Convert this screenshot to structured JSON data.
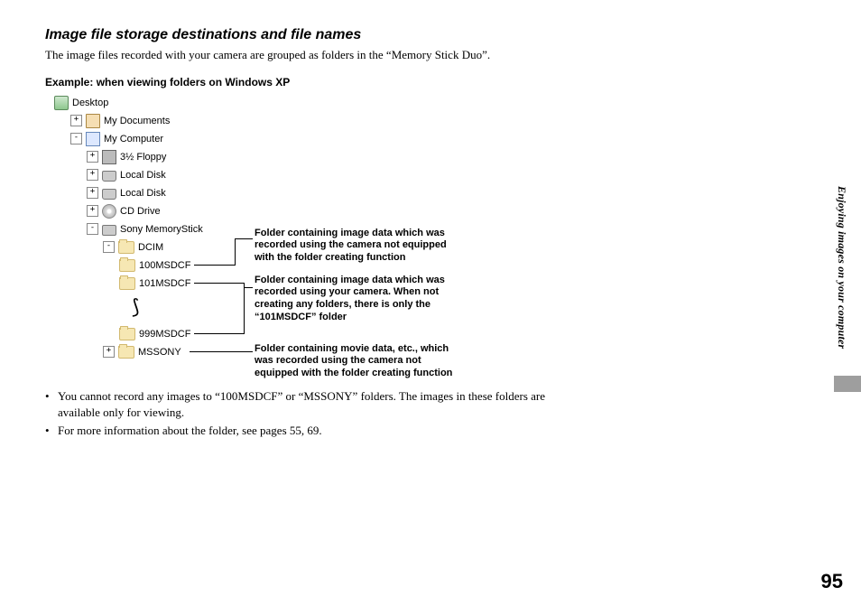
{
  "title": "Image file storage destinations and file names",
  "intro": "The image files recorded with your camera are grouped as folders in the “Memory Stick Duo”.",
  "example_label": "Example: when viewing folders on Windows XP",
  "tree": {
    "desktop": "Desktop",
    "documents": "My Documents",
    "computer": "My Computer",
    "floppy": "3½ Floppy",
    "local_disk_1": "Local Disk",
    "local_disk_2": "Local Disk",
    "cd_drive": "CD Drive",
    "memorystick": "Sony MemoryStick",
    "dcim": "DCIM",
    "f100": "100MSDCF",
    "f101": "101MSDCF",
    "f999": "999MSDCF",
    "mssony": "MSSONY"
  },
  "callouts": {
    "c1": "Folder containing image data which was recorded using the camera not equipped with the folder creating function",
    "c2": "Folder containing image data which was recorded using your camera. When not creating any folders, there is only the “101MSDCF” folder",
    "c3": "Folder containing movie data, etc., which was recorded using the camera not equipped with the folder creating function"
  },
  "bullets": {
    "b1": "You cannot record any images to “100MSDCF” or “MSSONY” folders. The images in these folders are available only for viewing.",
    "b2": "For more information about the folder, see pages 55, 69."
  },
  "side_tab": "Enjoying images on your computer",
  "page_number": "95"
}
